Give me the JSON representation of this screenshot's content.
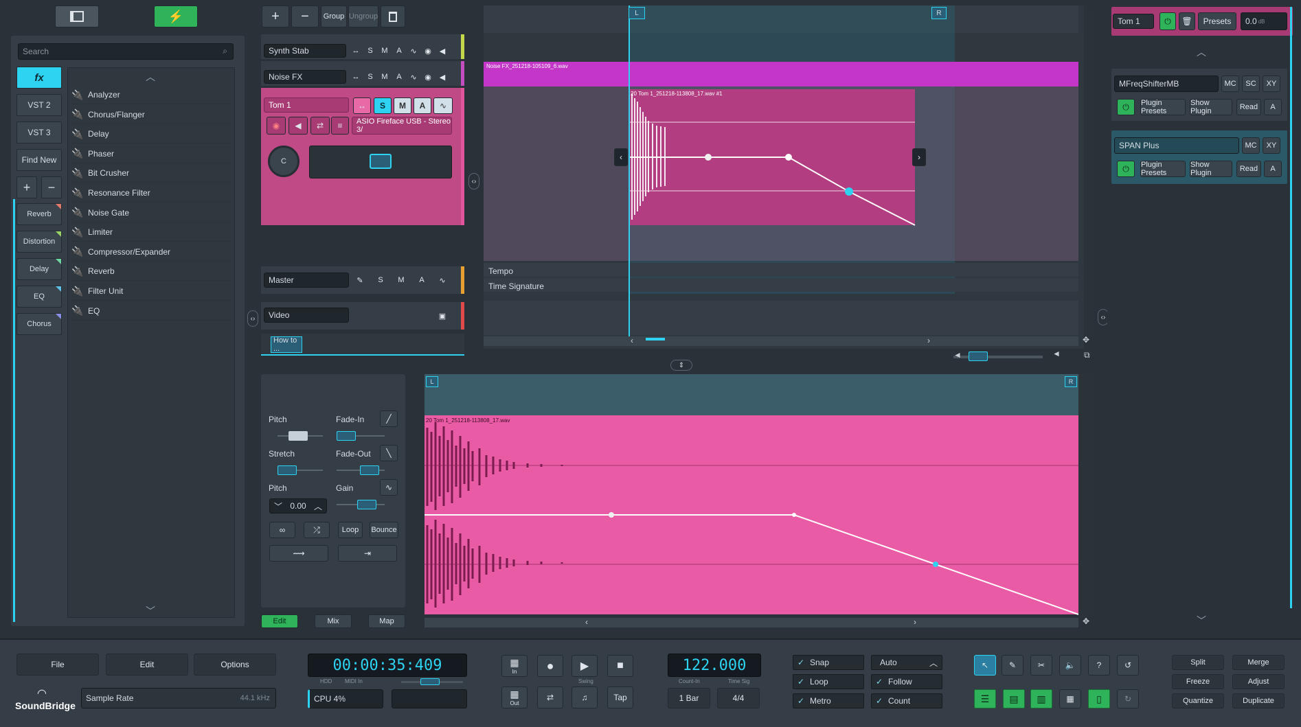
{
  "browser": {
    "search_placeholder": "Search",
    "fx_label": "fx",
    "vst2_label": "VST 2",
    "vst3_label": "VST 3",
    "findnew_label": "Find New",
    "plus": "+",
    "minus": "−",
    "categories": [
      {
        "label": "Reverb",
        "color": "#e07a6a"
      },
      {
        "label": "Distortion",
        "color": "#9bd36a"
      },
      {
        "label": "Delay",
        "color": "#6fd6a0"
      },
      {
        "label": "EQ",
        "color": "#5fbfe6"
      },
      {
        "label": "Chorus",
        "color": "#8a8fe6"
      }
    ],
    "effects": [
      "Analyzer",
      "Chorus/Flanger",
      "Delay",
      "Phaser",
      "Bit Crusher",
      "Resonance Filter",
      "Noise Gate",
      "Limiter",
      "Compressor/Expander",
      "Reverb",
      "Filter Unit",
      "EQ"
    ]
  },
  "tracks_toolbar": {
    "add": "+",
    "remove": "−",
    "group": "Group",
    "ungroup": "Ungroup"
  },
  "tracks": [
    {
      "name": "Synth Stab",
      "s": "S",
      "m": "M",
      "a": "A",
      "color": "#c3d84a"
    },
    {
      "name": "Noise FX",
      "s": "S",
      "m": "M",
      "a": "A",
      "color": "#c44dbf"
    },
    {
      "name": "Tom 1",
      "s": "S",
      "m": "M",
      "a": "A",
      "input": "ASIO Fireface USB - Stereo 3/",
      "pan": "C",
      "color": "#e0559c"
    }
  ],
  "master": {
    "name": "Master",
    "s": "S",
    "m": "M",
    "a": "A"
  },
  "video": {
    "name": "Video"
  },
  "tab": {
    "label": "How to ..."
  },
  "arranger": {
    "locator_l": "L",
    "locator_r": "R",
    "clip_noise": "Noise FX_251218-105109_6.wav",
    "clip_tom": "20 Tom 1_251218-113808_17.wav #1",
    "tempo": "Tempo",
    "time_signature": "Time Signature"
  },
  "editor": {
    "pitch": "Pitch",
    "fade_in": "Fade-In",
    "stretch": "Stretch",
    "fade_out": "Fade-Out",
    "pitch2": "Pitch",
    "gain": "Gain",
    "pitch_value": "0.00",
    "loop": "Loop",
    "bounce": "Bounce",
    "tabs": [
      "Edit",
      "Mix",
      "Map"
    ],
    "clip_label": "20 Tom 1_251218-113808_17.wav"
  },
  "rack": {
    "track_name": "Tom 1",
    "presets": "Presets",
    "volume": "0.0",
    "volume_unit": "dB",
    "plugins": [
      {
        "name": "MFreqShifterMB",
        "mc": "MC",
        "sc": "SC",
        "xy": "XY",
        "presets": "Plugin Presets",
        "show": "Show Plugin",
        "read": "Read",
        "a": "A"
      },
      {
        "name": "SPAN Plus",
        "mc": "MC",
        "xy": "XY",
        "presets": "Plugin Presets",
        "show": "Show Plugin",
        "read": "Read",
        "a": "A"
      }
    ]
  },
  "transport": {
    "file": "File",
    "edit": "Edit",
    "options": "Options",
    "logo": "SoundBridge",
    "sample_rate": "Sample Rate",
    "sample_rate_value": "44.1 kHz",
    "time": "00:00:35:409",
    "hdd": "HDD",
    "midi_in": "MIDI In",
    "cpu": "CPU 4%",
    "in_label": "In",
    "out_label": "Out",
    "swing": "Swing",
    "tap": "Tap",
    "tempo": "122.000",
    "count_in": "Count-In",
    "time_sig_label": "Time Sig",
    "count_in_value": "1 Bar",
    "time_sig_value": "4/4",
    "snap": "Snap",
    "loop": "Loop",
    "metro": "Metro",
    "auto": "Auto",
    "follow": "Follow",
    "count": "Count",
    "split": "Split",
    "merge": "Merge",
    "freeze": "Freeze",
    "adjust": "Adjust",
    "quantize": "Quantize",
    "duplicate": "Duplicate"
  }
}
